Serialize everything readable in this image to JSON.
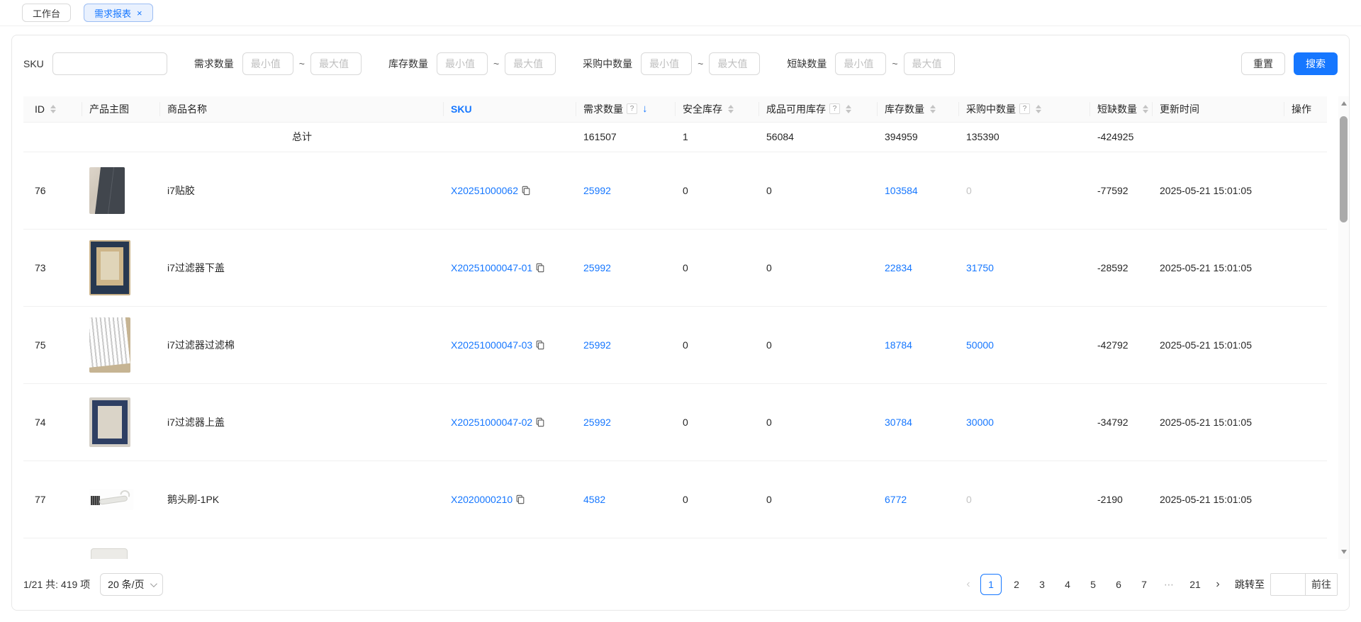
{
  "tabs": [
    {
      "label": "工作台",
      "active": false
    },
    {
      "label": "需求报表",
      "active": true
    }
  ],
  "icons": {
    "close": "×",
    "help": "?",
    "sort_desc_arrow": "↓",
    "prev": "‹",
    "next": "›",
    "ellipsis": "⋯"
  },
  "colors": {
    "primary": "#1677ff",
    "active_tab_bg": "#e9f1fe",
    "header_bg": "#fafafa",
    "muted_text": "#c3c3c3"
  },
  "filters": {
    "sku_label": "SKU",
    "sku_value": "",
    "separator": "~",
    "groups": [
      {
        "label": "需求数量",
        "min_placeholder": "最小值",
        "max_placeholder": "最大值"
      },
      {
        "label": "库存数量",
        "min_placeholder": "最小值",
        "max_placeholder": "最大值"
      },
      {
        "label": "采购中数量",
        "min_placeholder": "最小值",
        "max_placeholder": "最大值"
      },
      {
        "label": "短缺数量",
        "min_placeholder": "最小值",
        "max_placeholder": "最大值"
      }
    ],
    "reset_label": "重置",
    "search_label": "搜索"
  },
  "table": {
    "columns": [
      {
        "label": "ID",
        "sorter": true
      },
      {
        "label": "产品主图"
      },
      {
        "label": "商品名称"
      },
      {
        "label": "SKU",
        "highlighted": true
      },
      {
        "label": "需求数量",
        "help": true,
        "sorted": "desc"
      },
      {
        "label": "安全库存",
        "sorter": true
      },
      {
        "label": "成品可用库存",
        "help": true,
        "sorter": true
      },
      {
        "label": "库存数量",
        "sorter": true
      },
      {
        "label": "采购中数量",
        "help": true,
        "sorter": true
      },
      {
        "label": "短缺数量",
        "sorter": true
      },
      {
        "label": "更新时间"
      },
      {
        "label": "操作"
      }
    ],
    "summary": {
      "label": "总计",
      "demand": "161507",
      "safety": "1",
      "finished_available": "56084",
      "stock": "394959",
      "purchasing": "135390",
      "shortage": "-424925"
    },
    "rows": [
      {
        "id": "76",
        "image": "dark-adhesive-strip",
        "name": "i7贴胶",
        "sku": "X20251000062",
        "demand": "25992",
        "safety": "0",
        "finished_available": "0",
        "stock": "103584",
        "purchasing": "0",
        "purchasing_muted": true,
        "shortage": "-77592",
        "updated": "2025-05-21 15:01:05"
      },
      {
        "id": "73",
        "image": "filter-bottom-cover",
        "name": "i7过滤器下盖",
        "sku": "X20251000047-01",
        "demand": "25992",
        "safety": "0",
        "finished_available": "0",
        "stock": "22834",
        "purchasing": "31750",
        "purchasing_muted": false,
        "shortage": "-28592",
        "updated": "2025-05-21 15:01:05"
      },
      {
        "id": "75",
        "image": "filter-cotton",
        "name": "i7过滤器过滤棉",
        "sku": "X20251000047-03",
        "demand": "25992",
        "safety": "0",
        "finished_available": "0",
        "stock": "18784",
        "purchasing": "50000",
        "purchasing_muted": false,
        "shortage": "-42792",
        "updated": "2025-05-21 15:01:05"
      },
      {
        "id": "74",
        "image": "filter-top-cover",
        "name": "i7过滤器上盖",
        "sku": "X20251000047-02",
        "demand": "25992",
        "safety": "0",
        "finished_available": "0",
        "stock": "30784",
        "purchasing": "30000",
        "purchasing_muted": false,
        "shortage": "-34792",
        "updated": "2025-05-21 15:01:05"
      },
      {
        "id": "77",
        "image": "goose-head-brush",
        "name": "鹅头刷-1PK",
        "sku": "X2020000210",
        "demand": "4582",
        "safety": "0",
        "finished_available": "0",
        "stock": "6772",
        "purchasing": "0",
        "purchasing_muted": true,
        "shortage": "-2190",
        "updated": "2025-05-21 15:01:05"
      }
    ]
  },
  "pagination": {
    "total_text": "1/21 共: 419 项",
    "page_size_label": "20 条/页",
    "pages": [
      "1",
      "2",
      "3",
      "4",
      "5",
      "6",
      "7",
      "⋯",
      "21"
    ],
    "active_page": "1",
    "jump_label": "跳转至",
    "jump_value": "",
    "go_label": "前往"
  }
}
